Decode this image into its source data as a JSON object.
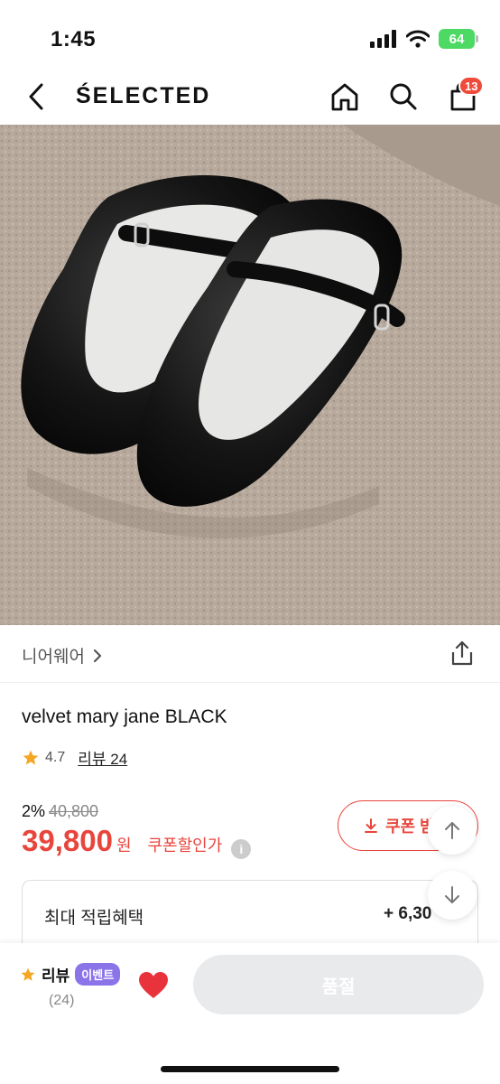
{
  "status_bar": {
    "time": "1:45",
    "battery": "64",
    "icons": [
      "signal-icon",
      "wifi-icon",
      "battery-icon"
    ]
  },
  "nav": {
    "brand": "ŚELECTED",
    "cart_count": "13",
    "icons": [
      "back-icon",
      "home-icon",
      "search-icon",
      "cart-icon"
    ]
  },
  "product": {
    "brand_name": "니어웨어",
    "title": "velvet mary jane BLACK",
    "rating": "4.7",
    "review_link": "리뷰 24",
    "discount_percent": "2%",
    "original_price": "40,800",
    "sale_price": "39,800",
    "currency": "원",
    "coupon_price_label": "쿠폰할인가",
    "info_symbol": "i",
    "coupon_button": "쿠폰 받",
    "points_label": "최대 적립혜택",
    "points_value": "+ 6,30"
  },
  "bottom_bar": {
    "review_label": "리뷰",
    "event_badge": "이벤트",
    "review_count": "(24)",
    "soldout_label": "품절"
  },
  "colors": {
    "accent_red": "#e8453c",
    "badge_red": "#f04a3a",
    "event_purple": "#8b74e8",
    "star_orange": "#f5a623",
    "heart_red": "#e8333d"
  }
}
